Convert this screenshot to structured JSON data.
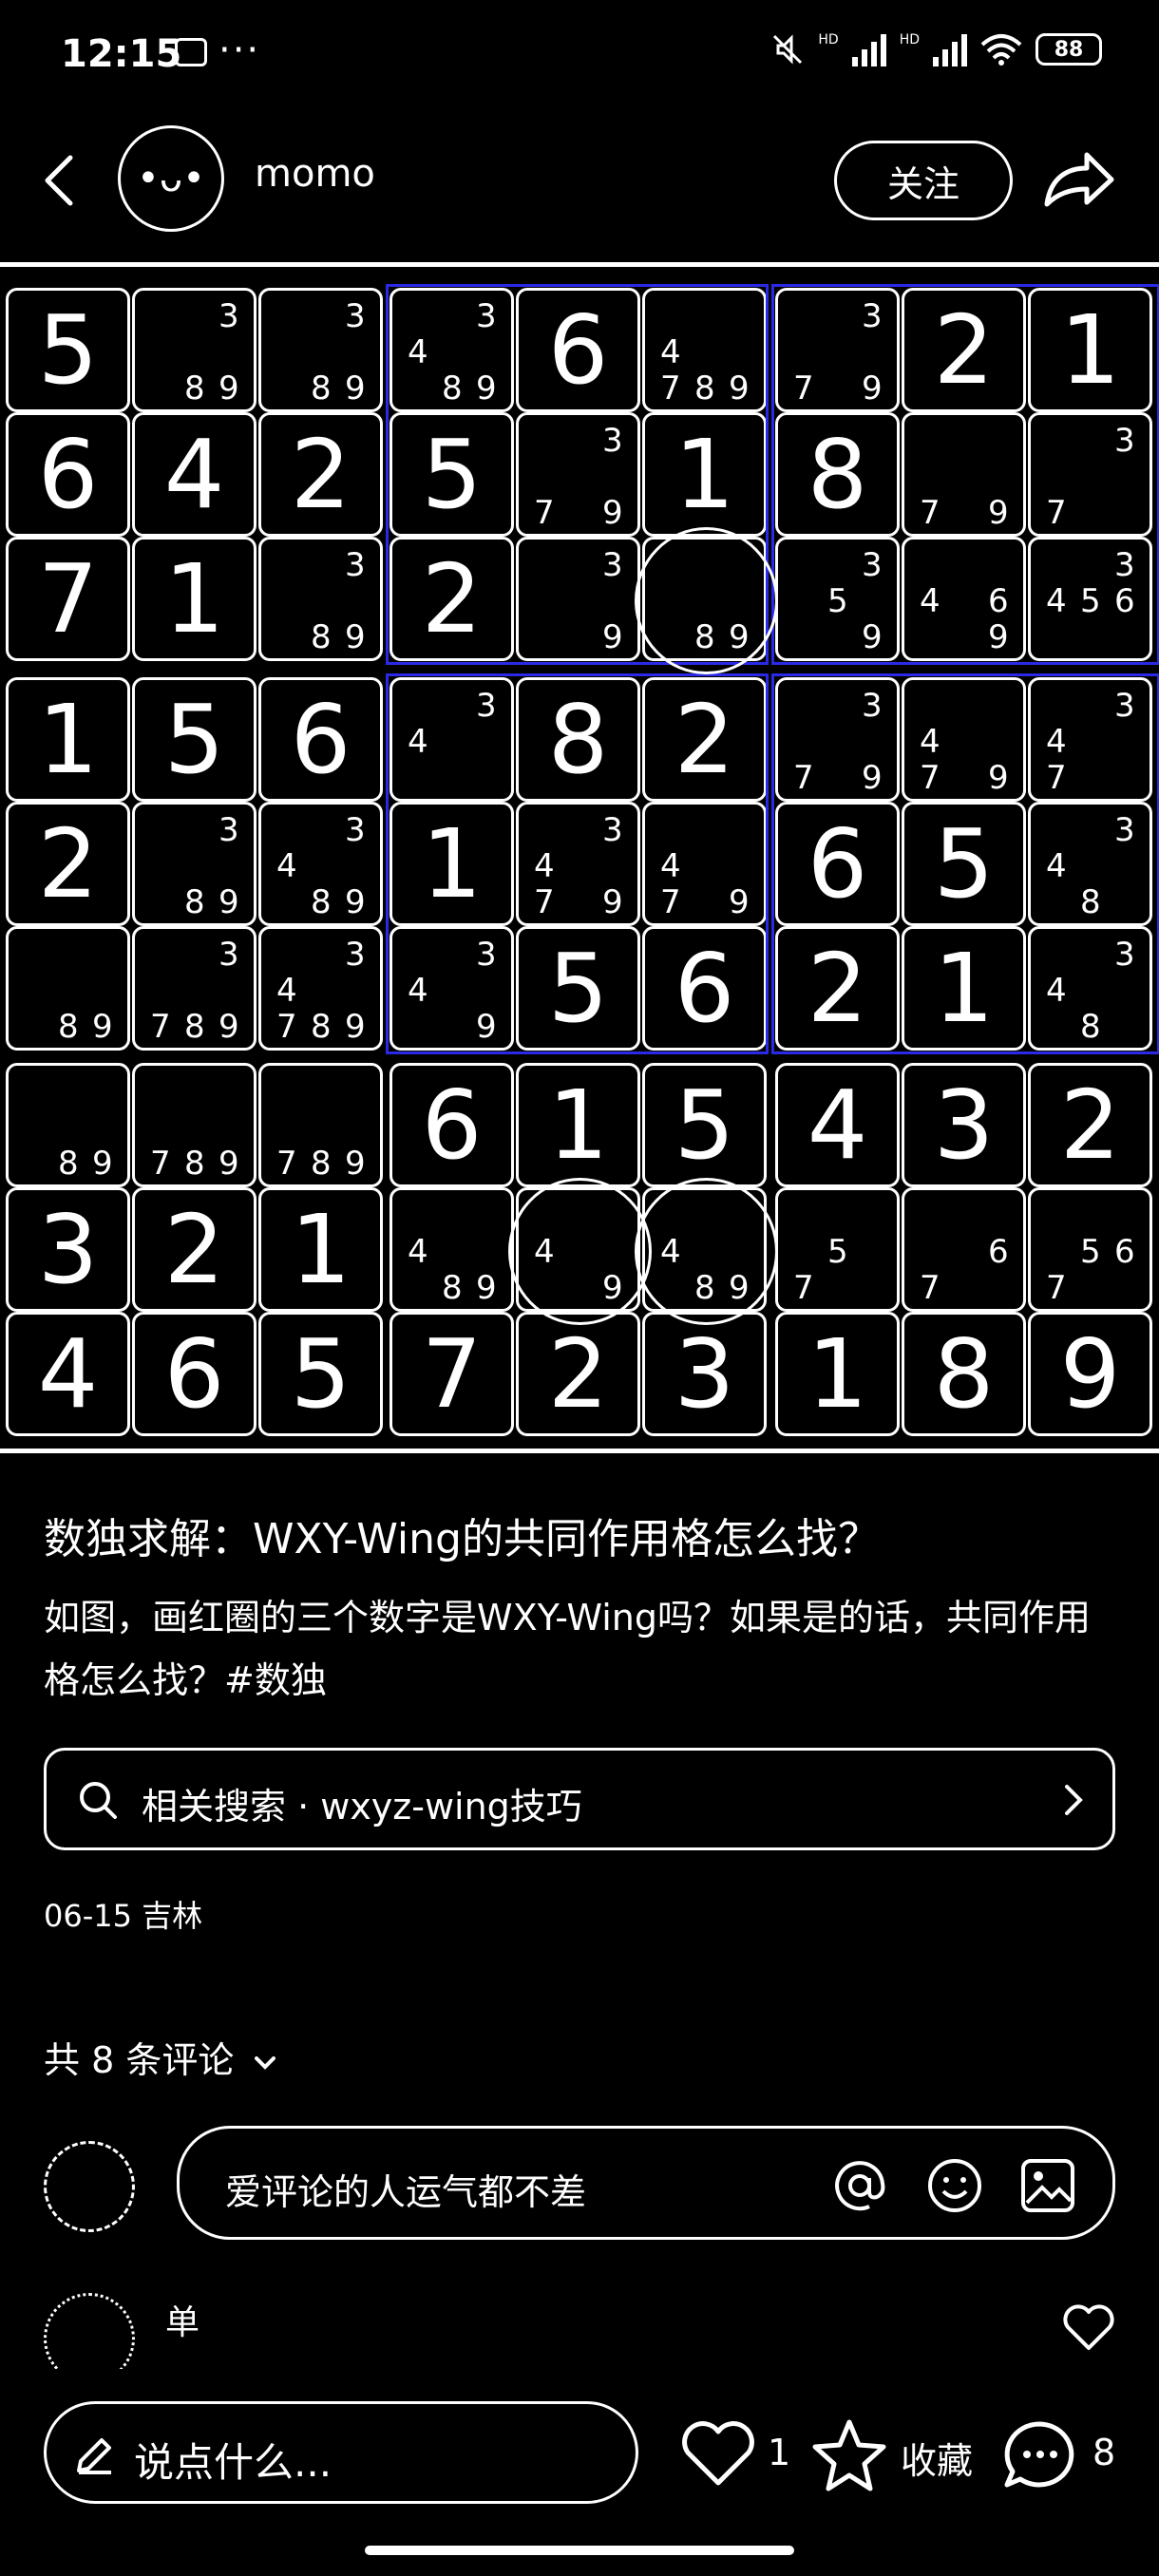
{
  "status_bar": {
    "time": "12:15",
    "more": "···",
    "battery": "88",
    "network_hd_1": "HD",
    "network_hd_2": "HD"
  },
  "header": {
    "username": "momo",
    "follow_label": "关注",
    "avatar_glyph": "•ᴗ•"
  },
  "sudoku": {
    "grid": [
      [
        5,
        0,
        0,
        0,
        6,
        0,
        0,
        2,
        1
      ],
      [
        6,
        4,
        2,
        5,
        0,
        1,
        8,
        0,
        0
      ],
      [
        7,
        1,
        0,
        2,
        0,
        0,
        0,
        0,
        0
      ],
      [
        1,
        5,
        6,
        0,
        8,
        2,
        0,
        0,
        0
      ],
      [
        2,
        0,
        0,
        1,
        0,
        0,
        6,
        5,
        0
      ],
      [
        0,
        0,
        0,
        0,
        5,
        6,
        2,
        1,
        0
      ],
      [
        0,
        0,
        0,
        6,
        1,
        5,
        4,
        3,
        2
      ],
      [
        3,
        2,
        1,
        0,
        0,
        0,
        0,
        0,
        0
      ],
      [
        4,
        6,
        5,
        7,
        2,
        3,
        1,
        8,
        9
      ]
    ],
    "candidates": [
      [
        [],
        [
          3,
          8,
          9
        ],
        [
          3,
          8,
          9
        ],
        [
          3,
          4,
          8,
          9
        ],
        [],
        [
          4,
          7,
          8,
          9
        ],
        [
          3,
          7,
          9
        ],
        [],
        []
      ],
      [
        [],
        [],
        [],
        [],
        [
          3,
          7,
          9
        ],
        [],
        [],
        [
          7,
          9
        ],
        [
          3,
          7
        ]
      ],
      [
        [],
        [],
        [
          3,
          8,
          9
        ],
        [],
        [
          3,
          9
        ],
        [
          8,
          9
        ],
        [
          3,
          5,
          9
        ],
        [
          4,
          6,
          9
        ],
        [
          3,
          4,
          5,
          6
        ]
      ],
      [
        [],
        [],
        [],
        [
          3,
          4
        ],
        [],
        [],
        [
          3,
          7,
          9
        ],
        [
          4,
          7,
          9
        ],
        [
          3,
          4,
          7
        ]
      ],
      [
        [],
        [
          3,
          8,
          9
        ],
        [
          3,
          4,
          8,
          9
        ],
        [],
        [
          3,
          4,
          7,
          9
        ],
        [
          4,
          7,
          9
        ],
        [],
        [],
        [
          3,
          4,
          8
        ]
      ],
      [
        [
          8,
          9
        ],
        [
          3,
          7,
          8,
          9
        ],
        [
          3,
          4,
          7,
          8,
          9
        ],
        [
          3,
          4,
          9
        ],
        [],
        [],
        [],
        [],
        [
          3,
          4,
          8
        ]
      ],
      [
        [
          8,
          9
        ],
        [
          7,
          8,
          9
        ],
        [
          7,
          8,
          9
        ],
        [],
        [],
        [],
        [],
        [],
        []
      ],
      [
        [],
        [],
        [],
        [
          4,
          8,
          9
        ],
        [
          4,
          9
        ],
        [
          4,
          8,
          9
        ],
        [
          5,
          7
        ],
        [
          6,
          7
        ],
        [
          5,
          6,
          7
        ]
      ],
      [
        [],
        [],
        [],
        [],
        [],
        [],
        [],
        [],
        []
      ]
    ]
  },
  "post": {
    "title": "数独求解：WXY-Wing的共同作用格怎么找？",
    "body": "如图，画红圈的三个数字是WXY-Wing吗？如果是的话，共同作用格怎么找？#数独",
    "related_search": "相关搜索 · wxyz-wing技巧",
    "date_location": "06-15 吉林"
  },
  "comments": {
    "count_label": "共 8 条评论",
    "input_placeholder": "爱评论的人运气都不差",
    "first_comment_author": "单"
  },
  "bottom_bar": {
    "say_placeholder": "说点什么...",
    "like_count": "1",
    "collect_label": "收藏",
    "comment_count": "8"
  }
}
